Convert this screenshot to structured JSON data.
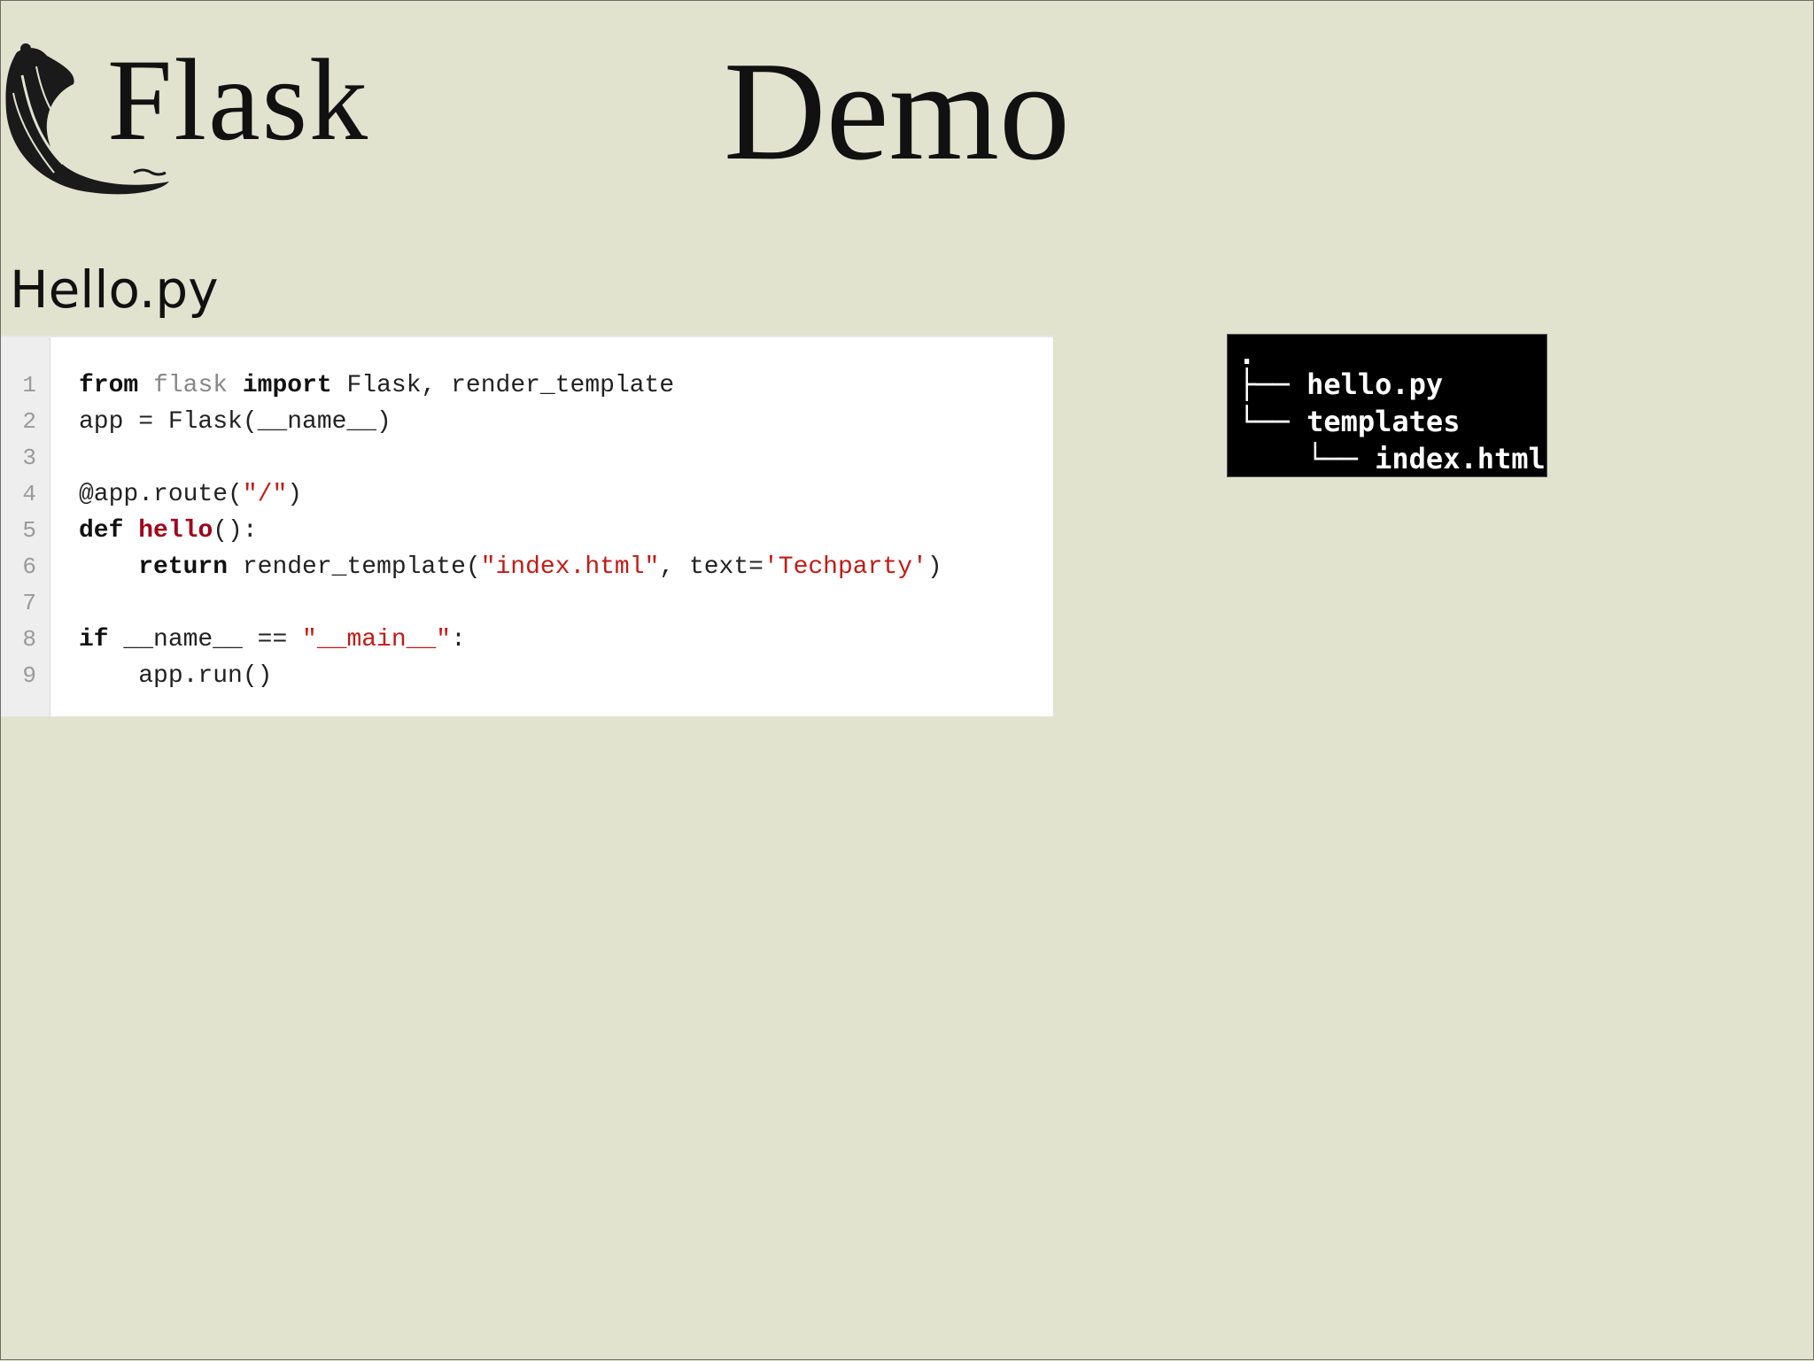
{
  "slide": {
    "logo_text": "Flask",
    "title": "Demo",
    "file_label": "Hello.py"
  },
  "code": {
    "lines": [
      {
        "num": "1",
        "tokens": [
          [
            "kw",
            "from"
          ],
          [
            "plain",
            " "
          ],
          [
            "mod",
            "flask"
          ],
          [
            "plain",
            " "
          ],
          [
            "kw",
            "import"
          ],
          [
            "plain",
            " Flask, render_template"
          ]
        ]
      },
      {
        "num": "2",
        "tokens": [
          [
            "plain",
            "app = Flask(__name__)"
          ]
        ]
      },
      {
        "num": "3",
        "tokens": []
      },
      {
        "num": "4",
        "tokens": [
          [
            "plain",
            "@app.route("
          ],
          [
            "str",
            "\"/\""
          ],
          [
            "plain",
            ")"
          ]
        ]
      },
      {
        "num": "5",
        "tokens": [
          [
            "kw",
            "def"
          ],
          [
            "plain",
            " "
          ],
          [
            "fn",
            "hello"
          ],
          [
            "plain",
            "():"
          ]
        ]
      },
      {
        "num": "6",
        "tokens": [
          [
            "plain",
            "    "
          ],
          [
            "kw",
            "return"
          ],
          [
            "plain",
            " render_template("
          ],
          [
            "str",
            "\"index.html\""
          ],
          [
            "plain",
            ", text="
          ],
          [
            "str",
            "'Techparty'"
          ],
          [
            "plain",
            ")"
          ]
        ]
      },
      {
        "num": "7",
        "tokens": []
      },
      {
        "num": "8",
        "tokens": [
          [
            "kw",
            "if"
          ],
          [
            "plain",
            " __name__ == "
          ],
          [
            "str",
            "\"__main__\""
          ],
          [
            "plain",
            ":"
          ]
        ]
      },
      {
        "num": "9",
        "tokens": [
          [
            "plain",
            "    app.run()"
          ]
        ]
      }
    ]
  },
  "tree": {
    "lines": [
      ".",
      "├── hello.py",
      "└── templates",
      "    └── index.html"
    ]
  },
  "colors": {
    "background": "#e1e3cf",
    "keyword": "#111111",
    "function_name": "#a1001a",
    "string": "#c41a16",
    "module": "#888888",
    "tree_bg": "#000000"
  },
  "icons": {
    "logo": "flask-horn-icon"
  }
}
